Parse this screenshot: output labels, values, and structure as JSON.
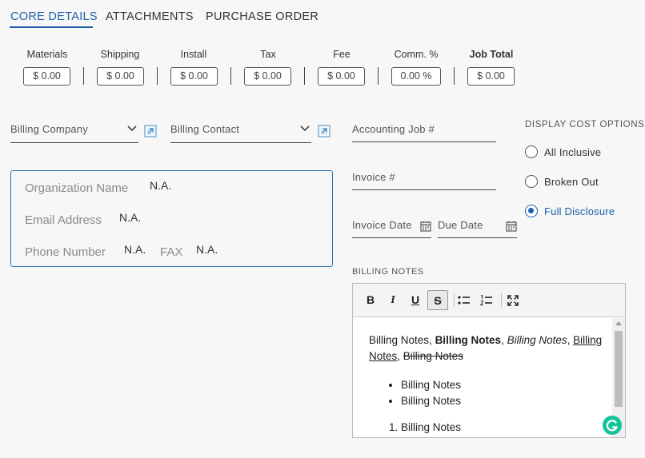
{
  "tabs": [
    {
      "label": "CORE DETAILS",
      "active": true
    },
    {
      "label": "ATTACHMENTS",
      "active": false
    },
    {
      "label": "PURCHASE ORDER",
      "active": false
    }
  ],
  "costs": [
    {
      "label": "Materials",
      "value": "$ 0.00"
    },
    {
      "label": "Shipping",
      "value": "$ 0.00"
    },
    {
      "label": "Install",
      "value": "$ 0.00"
    },
    {
      "label": "Tax",
      "value": "$ 0.00"
    },
    {
      "label": "Fee",
      "value": "$ 0.00"
    },
    {
      "label": "Comm. %",
      "value": "0.00 %"
    },
    {
      "label": "Job Total",
      "value": "$ 0.00"
    }
  ],
  "billing": {
    "company_label": "Billing Company",
    "contact_label": "Billing Contact",
    "accounting_job_label": "Accounting Job #",
    "invoice_label": "Invoice #",
    "invoice_date_label": "Invoice Date",
    "due_date_label": "Due Date"
  },
  "organization": {
    "name_label": "Organization Name",
    "name_value": "N.A.",
    "email_label": "Email Address",
    "email_value": "N.A.",
    "phone_label": "Phone Number",
    "phone_value": "N.A.",
    "fax_label": "FAX",
    "fax_value": "N.A."
  },
  "display_cost_options": {
    "title": "DISPLAY COST OPTIONS",
    "options": [
      {
        "label": "All Inclusive",
        "selected": false
      },
      {
        "label": "Broken Out",
        "selected": false
      },
      {
        "label": "Full Disclosure",
        "selected": true
      }
    ]
  },
  "billing_notes": {
    "title": "BILLING NOTES",
    "toolbar": [
      "bold",
      "italic",
      "underline",
      "strikethrough",
      "bulleted-list",
      "numbered-list",
      "fullscreen"
    ],
    "toolbar_glyphs": {
      "bold": "B",
      "italic": "I",
      "underline": "U",
      "strike": "S"
    },
    "paragraph": {
      "plain": "Billing Notes",
      "sep1": ", ",
      "bold": "Billing Notes",
      "sep2": ", ",
      "italic": "Billing Notes",
      "sep3": ", ",
      "underline": "Billing Notes",
      "sep4": ", ",
      "strike": "Billing Notes"
    },
    "bullets": [
      "Billing Notes",
      "Billing Notes"
    ],
    "numbered": [
      "Billing Notes"
    ]
  },
  "colors": {
    "accent": "#1f5fa8",
    "grammarly": "#15c39a"
  }
}
